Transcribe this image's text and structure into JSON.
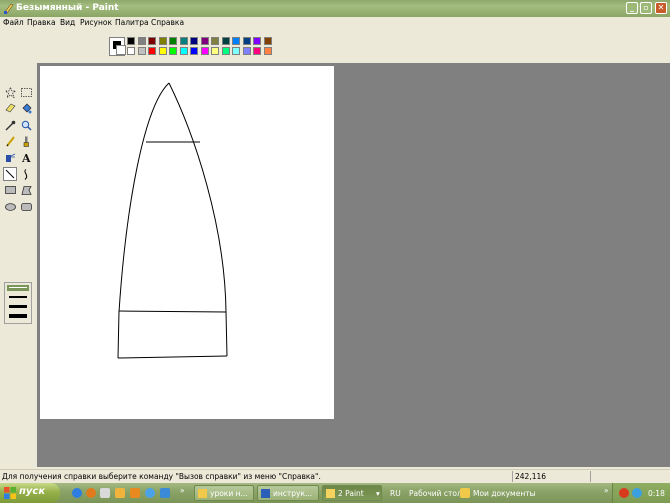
{
  "window": {
    "title": "Безымянный - Paint"
  },
  "menu": [
    "Файл",
    "Правка",
    "Вид",
    "Рисунок",
    "Палитра",
    "Справка"
  ],
  "palette": {
    "top": [
      "#000000",
      "#808080",
      "#800000",
      "#808000",
      "#008000",
      "#008080",
      "#000080",
      "#800080",
      "#808040",
      "#004040",
      "#0080ff",
      "#004080",
      "#8000ff",
      "#804000"
    ],
    "bottom": [
      "#ffffff",
      "#c0c0c0",
      "#ff0000",
      "#ffff00",
      "#00ff00",
      "#00ffff",
      "#0000ff",
      "#ff00ff",
      "#ffff80",
      "#00ff80",
      "#80ffff",
      "#8080ff",
      "#ff0080",
      "#ff8040"
    ],
    "foreground": "#000000",
    "background": "#ffffff"
  },
  "tools": [
    "free-select",
    "rect-select",
    "eraser",
    "fill",
    "picker",
    "magnifier",
    "pencil",
    "brush",
    "airbrush",
    "text",
    "line",
    "curve",
    "rectangle",
    "polygon",
    "ellipse",
    "rounded-rect"
  ],
  "selected_tool": "line",
  "status": {
    "message": "Для получения справки выберите команду \"Вызов справки\" из меню \"Справка\".",
    "coords": "242,116"
  },
  "taskbar": {
    "start_label": "пуск",
    "tasks": [
      {
        "label": "уроки н..."
      },
      {
        "label": "инструк..."
      },
      {
        "label": "2 Paint"
      }
    ],
    "lang": "RU",
    "desktop_label": "Рабочий стол",
    "mydocs_label": "Мои документы",
    "clock": "0:18"
  },
  "colors": {
    "title_bar": "#97b271",
    "workspace": "#808080",
    "taskbar": "#8ca468"
  }
}
